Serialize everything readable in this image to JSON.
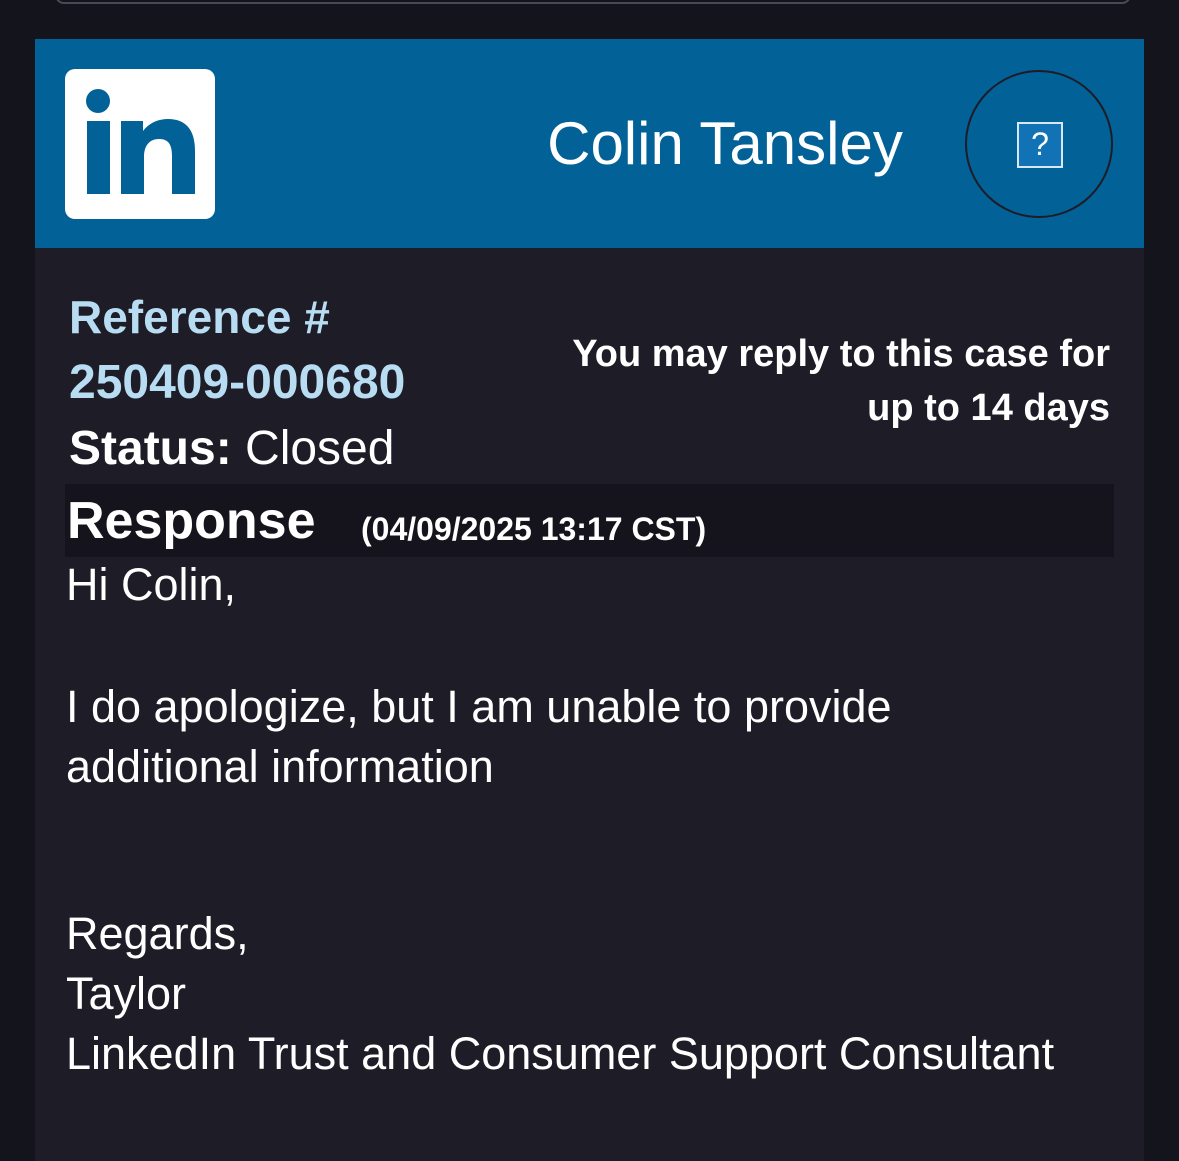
{
  "header": {
    "logo_text": "in",
    "user_name": "Colin Tansley",
    "help_label": "?",
    "logo_icon": "linkedin-logo-icon",
    "brand_color": "#026197"
  },
  "case": {
    "reference_label": "Reference #",
    "reference_number": "250409-000680",
    "status_label": "Status:",
    "status_value": "Closed",
    "reply_note_line1": "You may reply to this case for",
    "reply_note_line2": "up to 14 days"
  },
  "response": {
    "title": "Response",
    "timestamp": "(04/09/2025 13:17 CST)",
    "body": {
      "greeting": "Hi Colin,",
      "line1": "I do apologize, but I am unable to provide",
      "line2": "additional information",
      "regards": "Regards,",
      "signer_name": "Taylor",
      "signer_title": "LinkedIn Trust and Consumer Support Consultant"
    }
  }
}
